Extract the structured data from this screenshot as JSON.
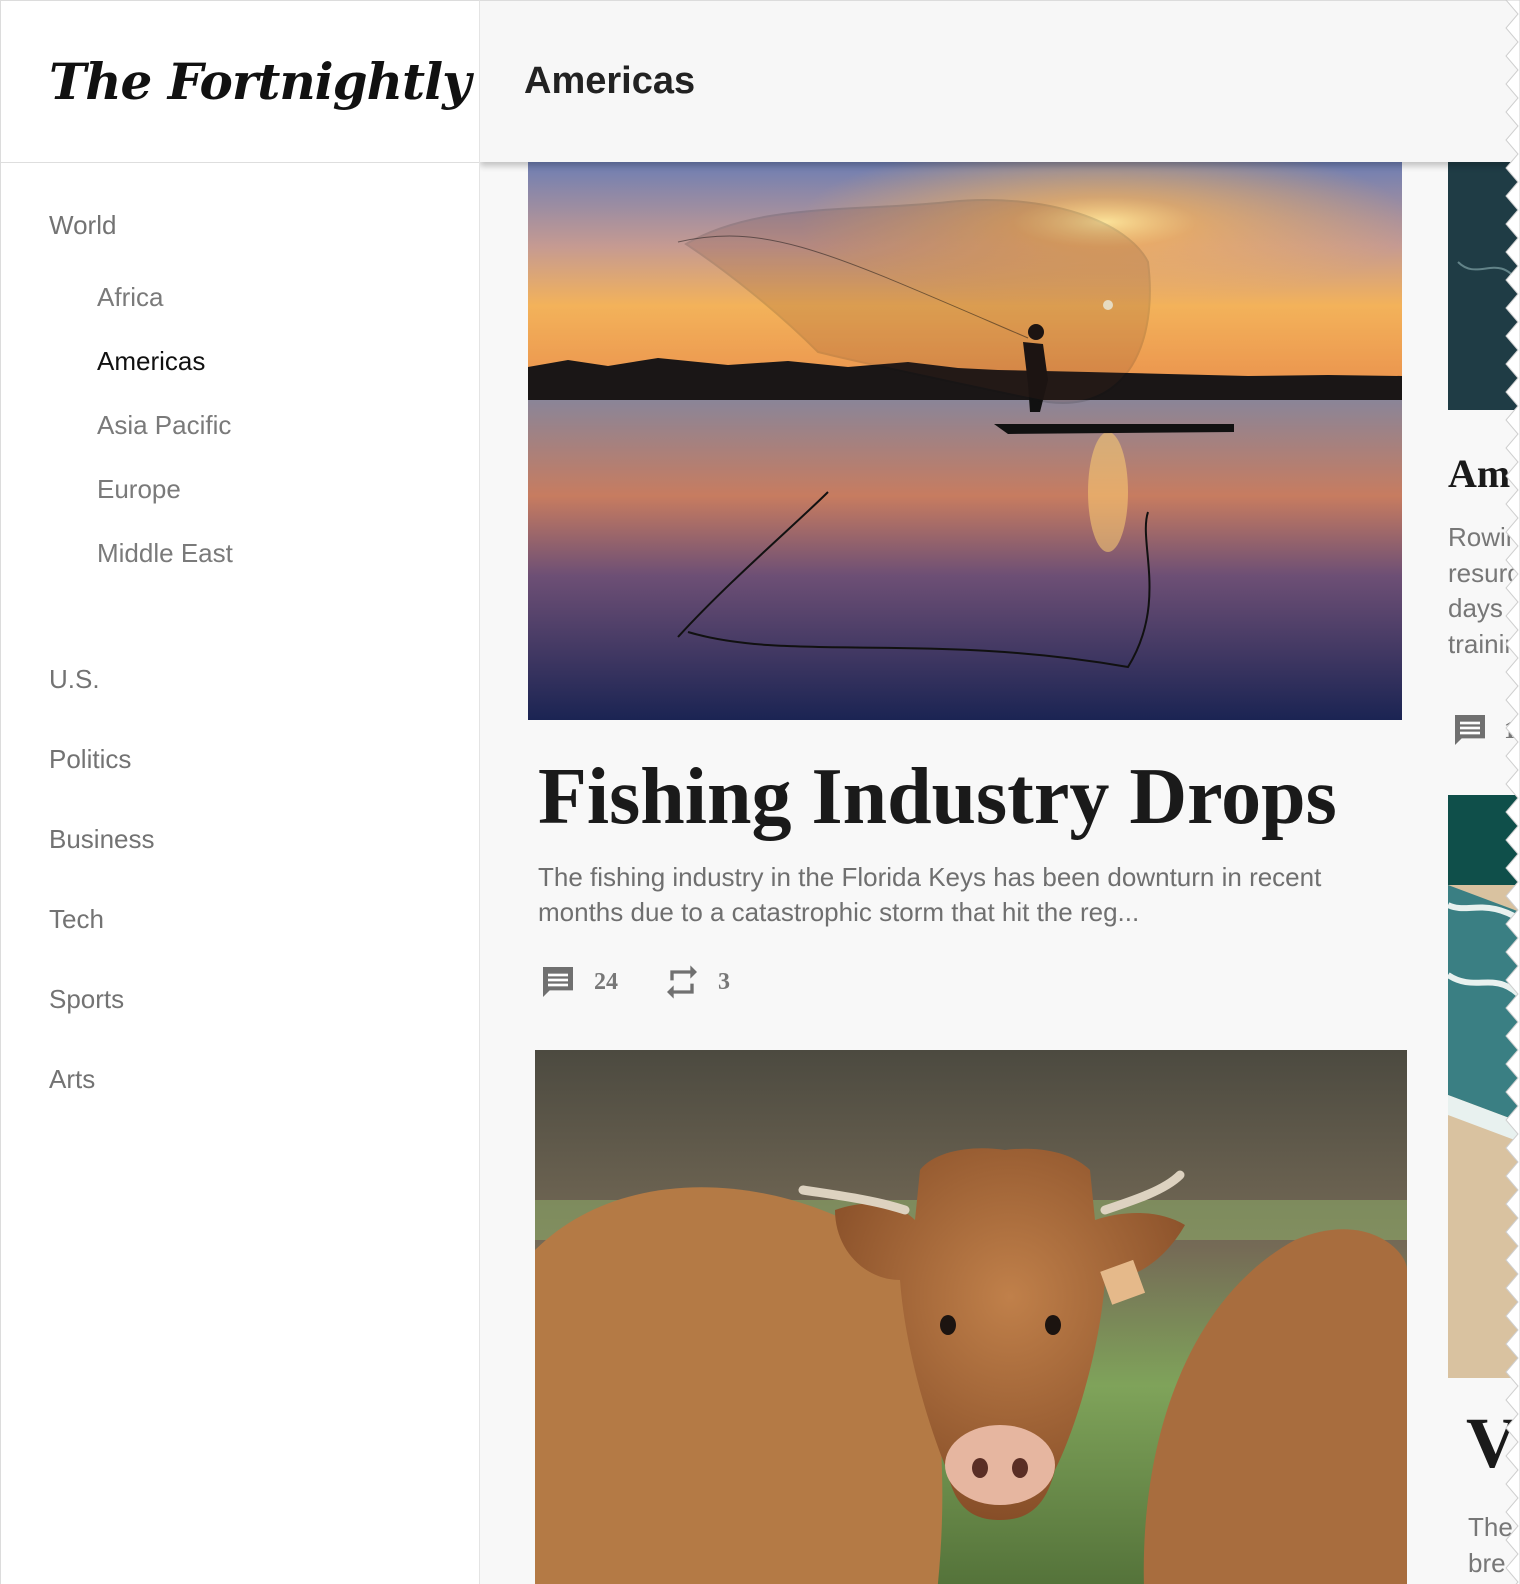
{
  "brand": {
    "name": "The Fortnightly"
  },
  "header": {
    "title": "Americas"
  },
  "sidebar": {
    "world": "World",
    "regions": [
      "Africa",
      "Americas",
      "Asia Pacific",
      "Europe",
      "Middle East"
    ],
    "active_region": "Americas",
    "sections": [
      "U.S.",
      "Politics",
      "Business",
      "Tech",
      "Sports",
      "Arts"
    ]
  },
  "feature": {
    "title": "Fishing Industry Drops",
    "summary_line1": "The fishing industry in the Florida Keys has been downturn in recent",
    "summary_line2": "months due to a catastrophic storm that hit the reg...",
    "comments": "24",
    "reposts": "3",
    "image_icon": "fisherman-sunset-image"
  },
  "second_card": {
    "image_icon": "cows-image"
  },
  "peek": {
    "title": "Am",
    "lines": [
      "Rowir",
      "resurc",
      "days",
      "trainir"
    ],
    "count": "1",
    "title2": "V",
    "lines2": [
      "The",
      "bre"
    ]
  },
  "colors": {
    "sidebar_bg": "#ffffff",
    "main_bg": "#f8f8f8",
    "muted_text": "#737373",
    "active_text": "#111111"
  }
}
